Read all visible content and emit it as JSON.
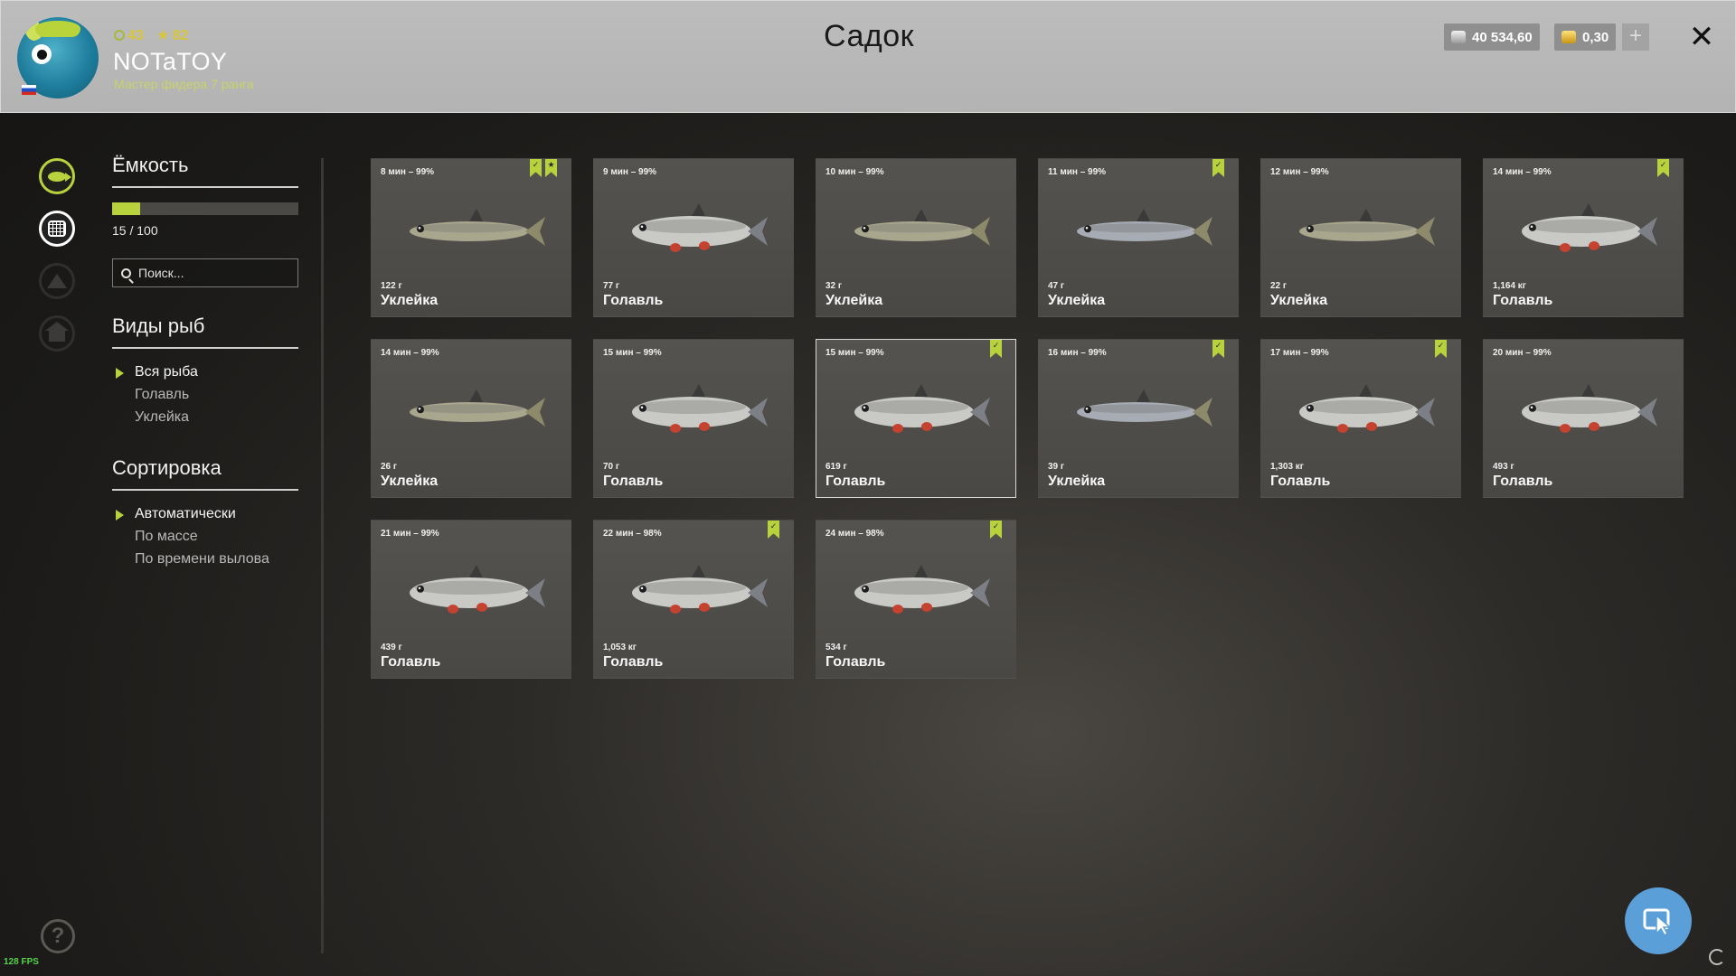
{
  "header": {
    "title": "Садок",
    "player": {
      "name": "NOTaTOY",
      "rank": "Мастер фидера 7 ранга",
      "level": "43",
      "stars": "82"
    },
    "currency": {
      "silver": "40 534,60",
      "gold": "0,30",
      "add_label": "+"
    },
    "close_label": "✕"
  },
  "sidebar_help": "?",
  "fps": "128 FPS",
  "capacity": {
    "title": "Ёмкость",
    "count": "15 / 100",
    "fill_fraction": 0.15
  },
  "search": {
    "placeholder": "Поиск..."
  },
  "fish_types": {
    "title": "Виды рыб",
    "items": [
      {
        "label": "Вся рыба",
        "selected": true
      },
      {
        "label": "Голавль",
        "selected": false
      },
      {
        "label": "Уклейка",
        "selected": false
      }
    ]
  },
  "sorting": {
    "title": "Сортировка",
    "items": [
      {
        "label": "Автоматически",
        "selected": true
      },
      {
        "label": "По массе",
        "selected": false
      },
      {
        "label": "По времени вылова",
        "selected": false
      }
    ]
  },
  "colors": {
    "accent": "#b7d23c",
    "chub_body": "#c9c9c6",
    "bleak_body": "#a9a68e",
    "fin_red": "#c4422f"
  },
  "catches": [
    {
      "time": "8 мин – 99%",
      "weight": "122 г",
      "name": "Уклейка",
      "kind": "bleak",
      "badges": [
        "check",
        "star"
      ],
      "selected": false
    },
    {
      "time": "9 мин – 99%",
      "weight": "77 г",
      "name": "Голавль",
      "kind": "chub",
      "badges": [],
      "selected": false
    },
    {
      "time": "10 мин – 99%",
      "weight": "32 г",
      "name": "Уклейка",
      "kind": "bleak",
      "badges": [],
      "selected": false
    },
    {
      "time": "11 мин – 99%",
      "weight": "47 г",
      "name": "Уклейка",
      "kind": "bleak_blue",
      "badges": [
        "check"
      ],
      "selected": false
    },
    {
      "time": "12 мин – 99%",
      "weight": "22 г",
      "name": "Уклейка",
      "kind": "bleak",
      "badges": [],
      "selected": false
    },
    {
      "time": "14 мин – 99%",
      "weight": "1,164 кг",
      "name": "Голавль",
      "kind": "chub",
      "badges": [
        "check"
      ],
      "selected": false
    },
    {
      "time": "14 мин – 99%",
      "weight": "26 г",
      "name": "Уклейка",
      "kind": "bleak",
      "badges": [],
      "selected": false
    },
    {
      "time": "15 мин – 99%",
      "weight": "70 г",
      "name": "Голавль",
      "kind": "chub",
      "badges": [],
      "selected": false
    },
    {
      "time": "15 мин – 99%",
      "weight": "619 г",
      "name": "Голавль",
      "kind": "chub",
      "badges": [
        "check"
      ],
      "selected": true
    },
    {
      "time": "16 мин – 99%",
      "weight": "39 г",
      "name": "Уклейка",
      "kind": "bleak_blue",
      "badges": [
        "check"
      ],
      "selected": false
    },
    {
      "time": "17 мин – 99%",
      "weight": "1,303 кг",
      "name": "Голавль",
      "kind": "chub",
      "badges": [
        "check"
      ],
      "selected": false
    },
    {
      "time": "20 мин – 99%",
      "weight": "493 г",
      "name": "Голавль",
      "kind": "chub",
      "badges": [],
      "selected": false
    },
    {
      "time": "21 мин – 99%",
      "weight": "439 г",
      "name": "Голавль",
      "kind": "chub",
      "badges": [],
      "selected": false
    },
    {
      "time": "22 мин – 98%",
      "weight": "1,053 кг",
      "name": "Голавль",
      "kind": "chub",
      "badges": [
        "check"
      ],
      "selected": false
    },
    {
      "time": "24 мин – 98%",
      "weight": "534 г",
      "name": "Голавль",
      "kind": "chub",
      "badges": [
        "check"
      ],
      "selected": false
    }
  ]
}
